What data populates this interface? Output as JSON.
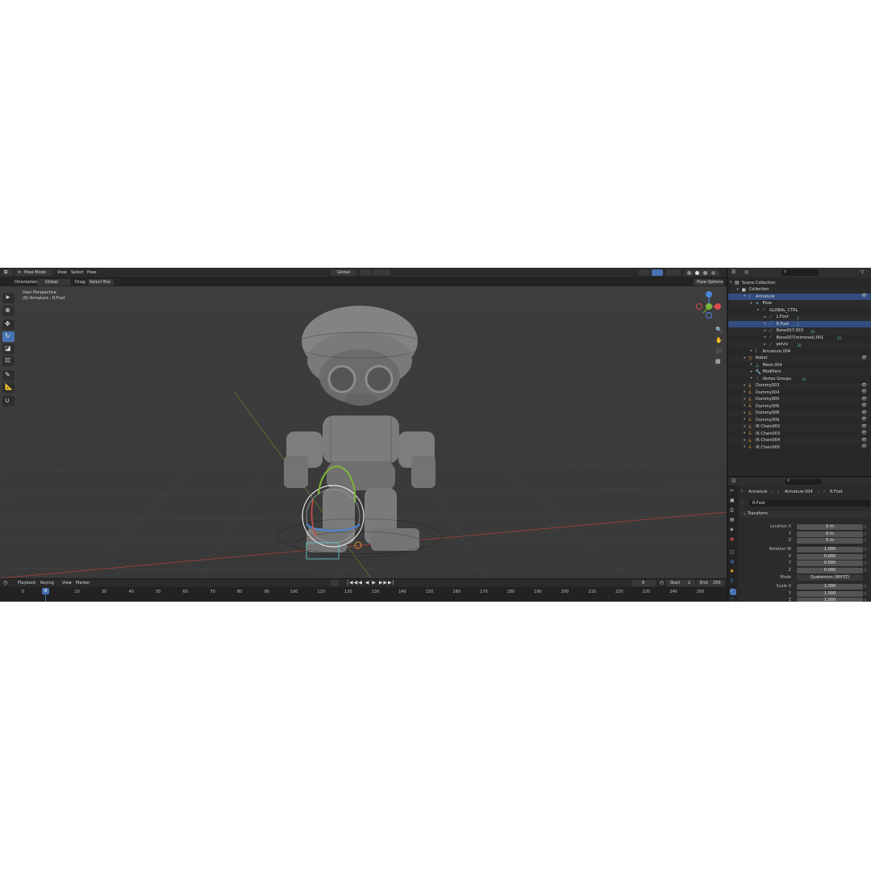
{
  "colors": {
    "accent": "#4772b3",
    "selected_row": "#334d80",
    "axis_x": "#d94a4a",
    "axis_y": "#7fb53a",
    "axis_z": "#4a86d9"
  },
  "header": {
    "mode": "Pose Mode",
    "menus": [
      "View",
      "Select",
      "Pose"
    ],
    "transform_orientation": "Global",
    "pose_options": "Pose Options"
  },
  "tool_header": {
    "orientation_label": "Orientation:",
    "orientation_value": "Global",
    "drag_label": "Drag:",
    "drag_value": "Select Box"
  },
  "viewport": {
    "perspective": "User Perspective",
    "active": "(8) Armature : R.Foot"
  },
  "outliner": {
    "search_placeholder": "",
    "rows": [
      {
        "label": "Scene Collection",
        "indent": 0,
        "icon": "scene-collection-icon"
      },
      {
        "label": "Collection",
        "indent": 1,
        "icon": "collection-icon"
      },
      {
        "label": "Armature",
        "indent": 2,
        "icon": "armature-icon",
        "selected": true
      },
      {
        "label": "Pose",
        "indent": 3,
        "icon": "pose-icon"
      },
      {
        "label": "GLOBAL_CTRL",
        "indent": 4,
        "icon": "bone-icon"
      },
      {
        "label": "L.Foot",
        "indent": 5,
        "icon": "bone-icon",
        "badge": "2"
      },
      {
        "label": "R.Foot",
        "indent": 5,
        "icon": "bone-icon",
        "badge": "2",
        "selected": true
      },
      {
        "label": "Bone007.003",
        "indent": 5,
        "icon": "bone-icon",
        "badge": "10"
      },
      {
        "label": "Bone007(mirrored).001",
        "indent": 5,
        "icon": "bone-icon",
        "badge": "10"
      },
      {
        "label": "pelvis",
        "indent": 5,
        "icon": "bone-icon",
        "badge": "30"
      },
      {
        "label": "Armature.004",
        "indent": 3,
        "icon": "armature-data-icon"
      },
      {
        "label": "Robot",
        "indent": 2,
        "icon": "mesh-object-icon"
      },
      {
        "label": "Mesh.004",
        "indent": 3,
        "icon": "mesh-icon"
      },
      {
        "label": "Modifiers",
        "indent": 3,
        "icon": "wrench-icon"
      },
      {
        "label": "Vertex Groups",
        "indent": 3,
        "icon": "vertex-groups-icon",
        "badge": "32"
      },
      {
        "label": "Dummy003",
        "indent": 2,
        "icon": "empty-icon"
      },
      {
        "label": "Dummy004",
        "indent": 2,
        "icon": "empty-icon"
      },
      {
        "label": "Dummy005",
        "indent": 2,
        "icon": "empty-icon"
      },
      {
        "label": "Dummy006",
        "indent": 2,
        "icon": "empty-icon"
      },
      {
        "label": "Dummy008",
        "indent": 2,
        "icon": "empty-icon"
      },
      {
        "label": "Dummy009",
        "indent": 2,
        "icon": "empty-icon"
      },
      {
        "label": "IK Chain002",
        "indent": 2,
        "icon": "empty-icon"
      },
      {
        "label": "IK Chain003",
        "indent": 2,
        "icon": "empty-icon"
      },
      {
        "label": "IK Chain004",
        "indent": 2,
        "icon": "empty-icon"
      },
      {
        "label": "IK Chain005",
        "indent": 2,
        "icon": "empty-icon"
      }
    ]
  },
  "properties": {
    "breadcrumb": [
      "Armature",
      "Armature.004",
      "R.Foot"
    ],
    "bone_name": "R.Foot",
    "panel_title": "Transform",
    "location": {
      "label": "Location X",
      "x": "0 m",
      "y": "0 m",
      "z": "0 m"
    },
    "rotation": {
      "label": "Rotation W",
      "w": "1.000",
      "x": "0.000",
      "y": "0.000",
      "z": "0.000"
    },
    "mode_label": "Mode",
    "mode_value": "Quaternion (WXYZ)",
    "scale": {
      "label": "Scale X",
      "x": "1.000",
      "y": "1.000",
      "z": "1.000"
    },
    "axis_labels": [
      "Y",
      "Z",
      "X",
      "Y",
      "Z"
    ]
  },
  "timeline": {
    "menus": [
      "Playback",
      "Keying",
      "View",
      "Marker"
    ],
    "current_frame": "8",
    "start_label": "Start",
    "start": "1",
    "end_label": "End",
    "end": "250",
    "ticks": [
      "0",
      "20",
      "30",
      "40",
      "50",
      "60",
      "70",
      "80",
      "90",
      "100",
      "110",
      "120",
      "130",
      "140",
      "150",
      "160",
      "170",
      "180",
      "190",
      "200",
      "210",
      "220",
      "230",
      "240",
      "250"
    ]
  }
}
